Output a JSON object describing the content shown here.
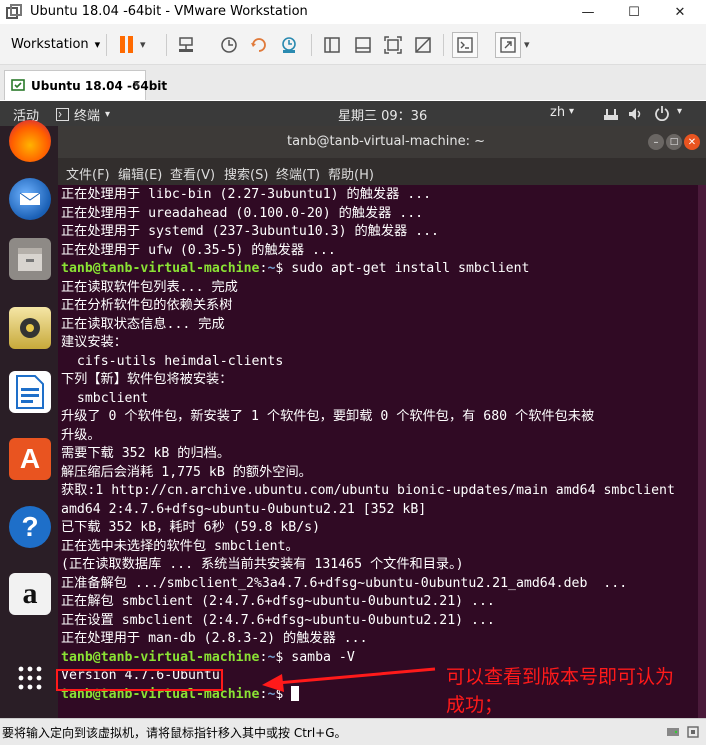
{
  "window": {
    "title": "Ubuntu 18.04 -64bit - VMware Workstation",
    "minimize": "—",
    "maximize": "☐",
    "close": "✕"
  },
  "toolbar": {
    "workstation_label": "Workstation",
    "dropdown": "▾"
  },
  "tab": {
    "label": "Ubuntu 18.04 -64bit",
    "close": "✕"
  },
  "ubuntu_topbar": {
    "activities": "活动",
    "app_menu": "终端",
    "clock": "星期三 09：36",
    "input_method": "zh"
  },
  "terminal": {
    "title": "tanb@tanb-virtual-machine: ~",
    "menu": [
      "文件(F)",
      "编辑(E)",
      "查看(V)",
      "搜索(S)",
      "终端(T)",
      "帮助(H)"
    ],
    "user_host": "tanb@tanb-virtual-machine",
    "path": "~",
    "prompt_suffix": "$ ",
    "lines": [
      {
        "text": "正在处理用于 libc-bin (2.27-3ubuntu1) 的触发器 ..."
      },
      {
        "text": "正在处理用于 ureadahead (0.100.0-20) 的触发器 ..."
      },
      {
        "text": "正在处理用于 systemd (237-3ubuntu10.3) 的触发器 ..."
      },
      {
        "text": "正在处理用于 ufw (0.35-5) 的触发器 ..."
      },
      {
        "prompt": true,
        "cmd": "sudo apt-get install smbclient"
      },
      {
        "text": "正在读取软件包列表... 完成"
      },
      {
        "text": "正在分析软件包的依赖关系树"
      },
      {
        "text": "正在读取状态信息... 完成"
      },
      {
        "text": "建议安装："
      },
      {
        "text": "  cifs-utils heimdal-clients"
      },
      {
        "text": "下列【新】软件包将被安装："
      },
      {
        "text": "  smbclient"
      },
      {
        "text": "升级了 0 个软件包，新安装了 1 个软件包，要卸载 0 个软件包，有 680 个软件包未被"
      },
      {
        "text": "升级。"
      },
      {
        "text": "需要下载 352 kB 的归档。"
      },
      {
        "text": "解压缩后会消耗 1,775 kB 的额外空间。"
      },
      {
        "text": "获取:1 http://cn.archive.ubuntu.com/ubuntu bionic-updates/main amd64 smbclient"
      },
      {
        "text": "amd64 2:4.7.6+dfsg~ubuntu-0ubuntu2.21 [352 kB]"
      },
      {
        "text": "已下载 352 kB，耗时 6秒 (59.8 kB/s)"
      },
      {
        "text": "正在选中未选择的软件包 smbclient。"
      },
      {
        "text": "(正在读取数据库 ... 系统当前共安装有 131465 个文件和目录。)"
      },
      {
        "text": "正准备解包 .../smbclient_2%3a4.7.6+dfsg~ubuntu-0ubuntu2.21_amd64.deb  ..."
      },
      {
        "text": "正在解包 smbclient (2:4.7.6+dfsg~ubuntu-0ubuntu2.21) ..."
      },
      {
        "text": "正在设置 smbclient (2:4.7.6+dfsg~ubuntu-0ubuntu2.21) ..."
      },
      {
        "text": "正在处理用于 man-db (2.8.3-2) 的触发器 ..."
      },
      {
        "prompt": true,
        "cmd": "samba -V"
      },
      {
        "text": "Version 4.7.6-Ubuntu",
        "highlight": true
      },
      {
        "prompt": true,
        "cmd": "",
        "cursor": true
      }
    ]
  },
  "annotation": {
    "line1": "可以查看到版本号即可认为",
    "line2": "成功；",
    "color": "#ff1a1a"
  },
  "dock": [
    {
      "name": "firefox-icon"
    },
    {
      "name": "thunderbird-icon"
    },
    {
      "name": "files-icon"
    },
    {
      "name": "rhythmbox-icon"
    },
    {
      "name": "libreoffice-writer-icon"
    },
    {
      "name": "ubuntu-software-icon",
      "label": "A"
    },
    {
      "name": "help-icon",
      "label": "?"
    },
    {
      "name": "amazon-icon",
      "label": "a"
    },
    {
      "name": "show-applications-icon"
    }
  ],
  "status_bar": {
    "text": "要将输入定向到该虚拟机，请将鼠标指针移入其中或按 Ctrl+G。"
  },
  "colors": {
    "terminal_bg": "#300a24",
    "prompt_green": "#8ae234",
    "path_blue": "#729fcf",
    "pause_orange": "#ff6a00"
  }
}
